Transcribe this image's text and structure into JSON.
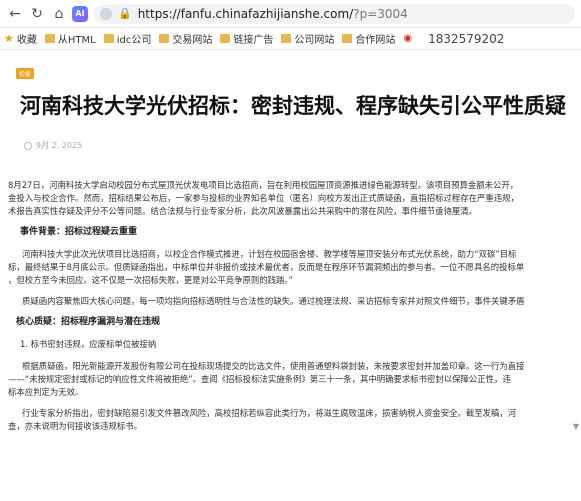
{
  "browser": {
    "ai_label": "AI",
    "url_base": "https://fanfu.chinafazhijianshe.com/",
    "url_query": "?p=3004"
  },
  "bookmarks": {
    "favorites_label": "收藏",
    "items": [
      {
        "label": "从HTML",
        "icon": "folder-icon"
      },
      {
        "label": "idc公司",
        "icon": "folder-icon"
      },
      {
        "label": "交易网站",
        "icon": "folder-icon"
      },
      {
        "label": "链接广告",
        "icon": "folder-icon"
      },
      {
        "label": "公司网站",
        "icon": "folder-icon"
      },
      {
        "label": "合作网站",
        "icon": "folder-icon"
      }
    ],
    "phone": "1832579202"
  },
  "article": {
    "tag": "松板",
    "title": "河南科技大学光伏招标：密封违规、程序缺失引公平性质疑",
    "date": "9月 2, 2025",
    "p1": "8月27日，河南科技大学启动校园分布式屋顶光伏发电项目比选招商，旨在利用校园屋顶资源推进绿色能源转型。该项目预算金额未公开，",
    "p1b": "金投入与校企合作。然而，招标结果公布后，一家参与投标的业界知名单位（匿名）向校方发出正式质疑函，直指招标过程存在严重违规，",
    "p1c": "术报告真实性存疑及评分不公等问题。结合法规与行业专家分析，此次风波暴露出公共采购中的潜在风险，事件细节亟待厘清。",
    "h1": "事件背景：招标过程疑云重重",
    "p2": "河南科技大学此次光伏项目比选招商，以校企合作模式推进，计划在校园宿舍楼、教学楼等屋顶安装分布式光伏系统，助力“双碳”目标",
    "p2b": "标，最终结果于8月底公示。但质疑函指出，中标单位并非报价或技术最优者，反而是在程序环节漏洞频出的参与者。一位不愿具名的投标单",
    "p2c": "，但校方至今未回应。这不仅是一次招标失败，更是对公平竞争原则的践踏。”",
    "p3": "质疑函内容聚焦四大核心问题，每一项均指向招标透明性与合法性的缺失。通过梳理法规、采访招标专家并对照文件细节，事件关键矛盾",
    "h2": "核心质疑：招标程序漏洞与潜在违规",
    "item1": "1. 标书密封违规，应废标单位被接纳",
    "p4": "根据质疑函，阳光新能源开发股份有限公司在投标现场提交的比选文件，使用普通塑料袋封装，未按要求密封并加盖印章。这一行为直接",
    "p4b": "——“未按规定密封或标记的响应性文件将被拒绝”。查阅《招标投标法实施条例》第三十一条，其中明确要求标书密封以保障公正性，违",
    "p4c": "标本应判定为无效。",
    "p5": "行业专家分析指出，密封缺陷易引发文件篡改风险，高校招标若纵容此类行为，将滋生腐败温床，损害纳税人资金安全。截至发稿，河",
    "p5b": "查，亦未说明为何接收该违规标书。"
  }
}
